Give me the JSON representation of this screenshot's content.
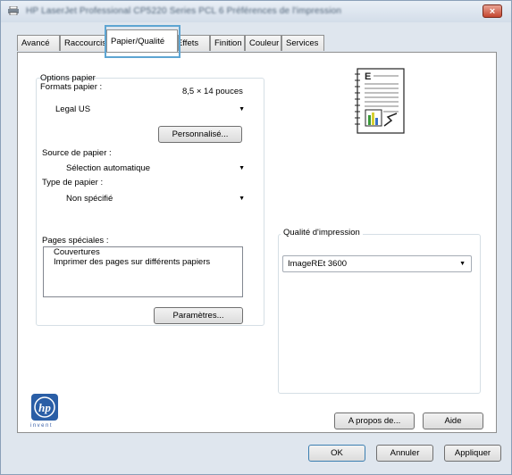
{
  "window": {
    "title": "HP LaserJet Professional CP5220 Series PCL 6 Préférences de l'impression",
    "close_label": "×"
  },
  "tabs": [
    {
      "label": "Avancé"
    },
    {
      "label": "Raccourcis"
    },
    {
      "label": "Papier/Qualité"
    },
    {
      "label": "Effets"
    },
    {
      "label": "Finition"
    },
    {
      "label": "Couleur"
    },
    {
      "label": "Services"
    }
  ],
  "paper_options": {
    "group_label": "Options papier",
    "sizes_label": "Formats papier :",
    "size_dimensions": "8,5 × 14 pouces",
    "size_value": "Legal US",
    "custom_button": "Personnalisé...",
    "source_label": "Source de papier :",
    "source_value": "Sélection automatique",
    "type_label": "Type de papier :",
    "type_value": "Non spécifié"
  },
  "special_pages": {
    "label": "Pages spéciales :",
    "items": [
      "Couvertures",
      "Imprimer des pages sur différents papiers"
    ],
    "settings_button": "Paramètres..."
  },
  "print_quality": {
    "group_label": "Qualité d'impression",
    "value": "ImageREt 3600"
  },
  "footer": {
    "logo_text": "invent",
    "about_button": "A propos de...",
    "help_button": "Aide",
    "ok_button": "OK",
    "cancel_button": "Annuler",
    "apply_button": "Appliquer"
  },
  "dropdown_arrow": "▼",
  "colors": {
    "accent": "#5ea5d2",
    "hp_blue": "#2a5ea6",
    "close_red": "#c4452f"
  }
}
